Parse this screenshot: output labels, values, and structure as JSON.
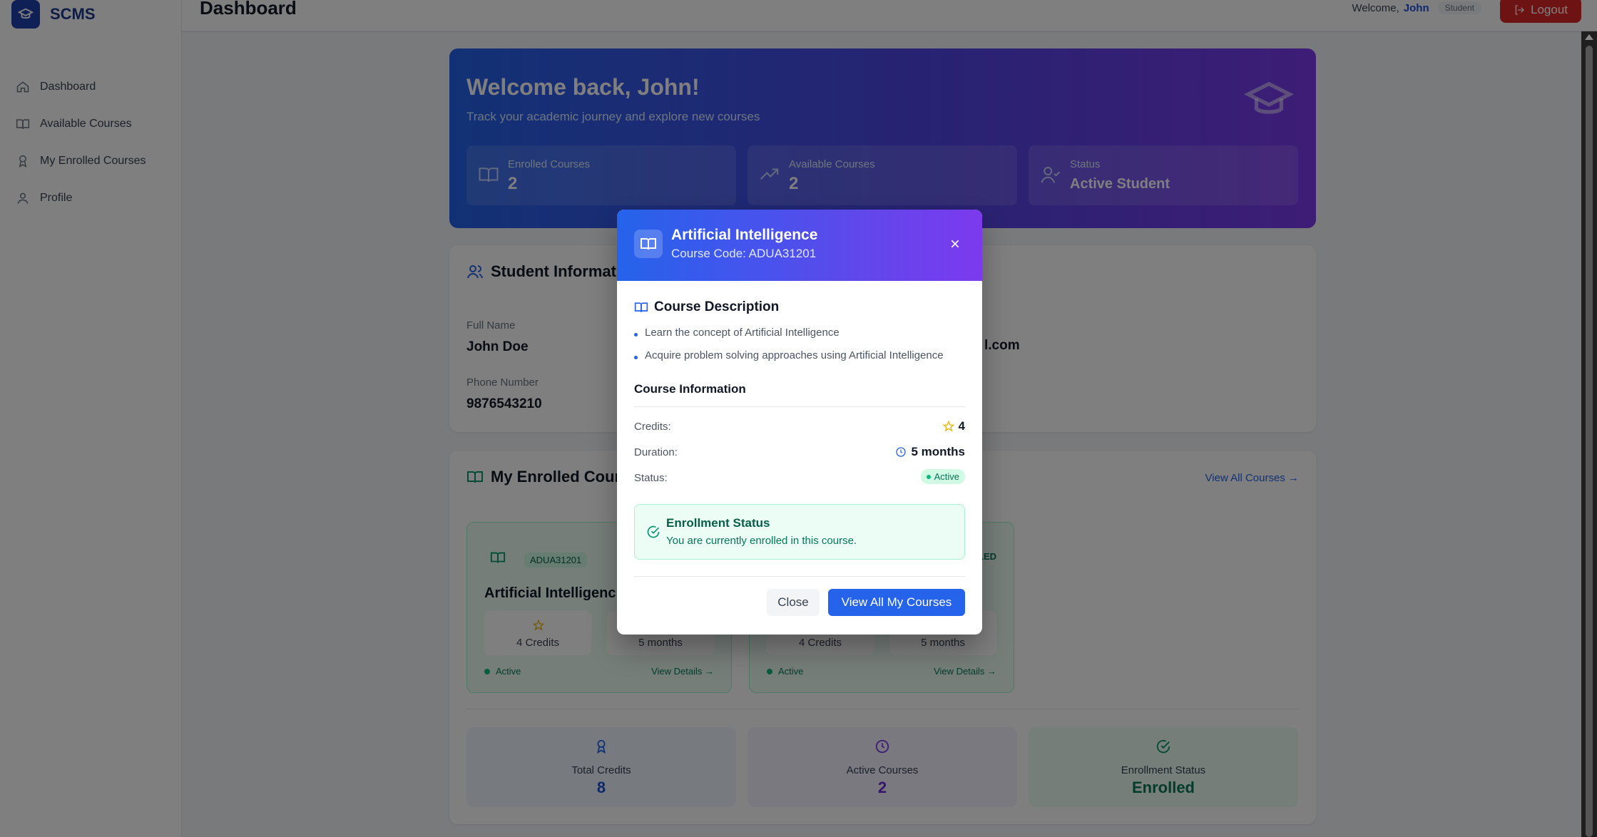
{
  "app": {
    "name": "SCMS"
  },
  "sidebar": {
    "items": [
      {
        "label": "Dashboard",
        "icon": "home-icon"
      },
      {
        "label": "Available Courses",
        "icon": "book-icon"
      },
      {
        "label": "My Enrolled Courses",
        "icon": "award-icon"
      },
      {
        "label": "Profile",
        "icon": "user-icon"
      }
    ]
  },
  "header": {
    "title": "Dashboard",
    "welcome_prefix": "Welcome,",
    "user_name": "John",
    "role": "Student",
    "logout_label": "Logout"
  },
  "hero": {
    "title": "Welcome back, John!",
    "subtitle": "Track your academic journey and explore new courses",
    "stats": [
      {
        "label": "Enrolled Courses",
        "value": "2"
      },
      {
        "label": "Available Courses",
        "value": "2"
      },
      {
        "label": "Status",
        "value": "Active Student"
      }
    ]
  },
  "student_info": {
    "title": "Student Informat",
    "full_name_label": "Full Name",
    "full_name": "John Doe",
    "phone_label": "Phone Number",
    "phone": "9876543210",
    "email_fragment": "l.com"
  },
  "enrolled": {
    "title": "My Enrolled Cours",
    "view_all": "View All Courses →",
    "cards": [
      {
        "code": "ADUA31201",
        "title": "Artificial Intelligenc",
        "credits": "4 Credits",
        "duration": "5 months",
        "status": "Active",
        "view": "View Details →"
      },
      {
        "tag": "LED",
        "credits": "4 Credits",
        "duration": "5 months",
        "status": "Active",
        "view": "View Details →"
      }
    ],
    "summary": [
      {
        "label": "Total Credits",
        "value": "8"
      },
      {
        "label": "Active Courses",
        "value": "2"
      },
      {
        "label": "Enrollment Status",
        "value": "Enrolled"
      }
    ]
  },
  "modal": {
    "title": "Artificial Intelligence",
    "code": "Course Code: ADUA31201",
    "description_title": "Course Description",
    "bullets": [
      "Learn the concept of Artificial Intelligence",
      "Acquire problem solving approaches using Artificial Intelligence"
    ],
    "info_title": "Course Information",
    "credits_label": "Credits:",
    "credits_value": "4",
    "duration_label": "Duration:",
    "duration_value": "5 months",
    "status_label": "Status:",
    "status_value": "Active",
    "enrollment_title": "Enrollment Status",
    "enrollment_text": "You are currently enrolled in this course.",
    "close_label": "Close",
    "primary_label": "View All My Courses"
  },
  "colors": {
    "accent": "#2563eb",
    "gradient_end": "#7c3aed",
    "danger": "#dc2626",
    "success": "#10b981"
  }
}
